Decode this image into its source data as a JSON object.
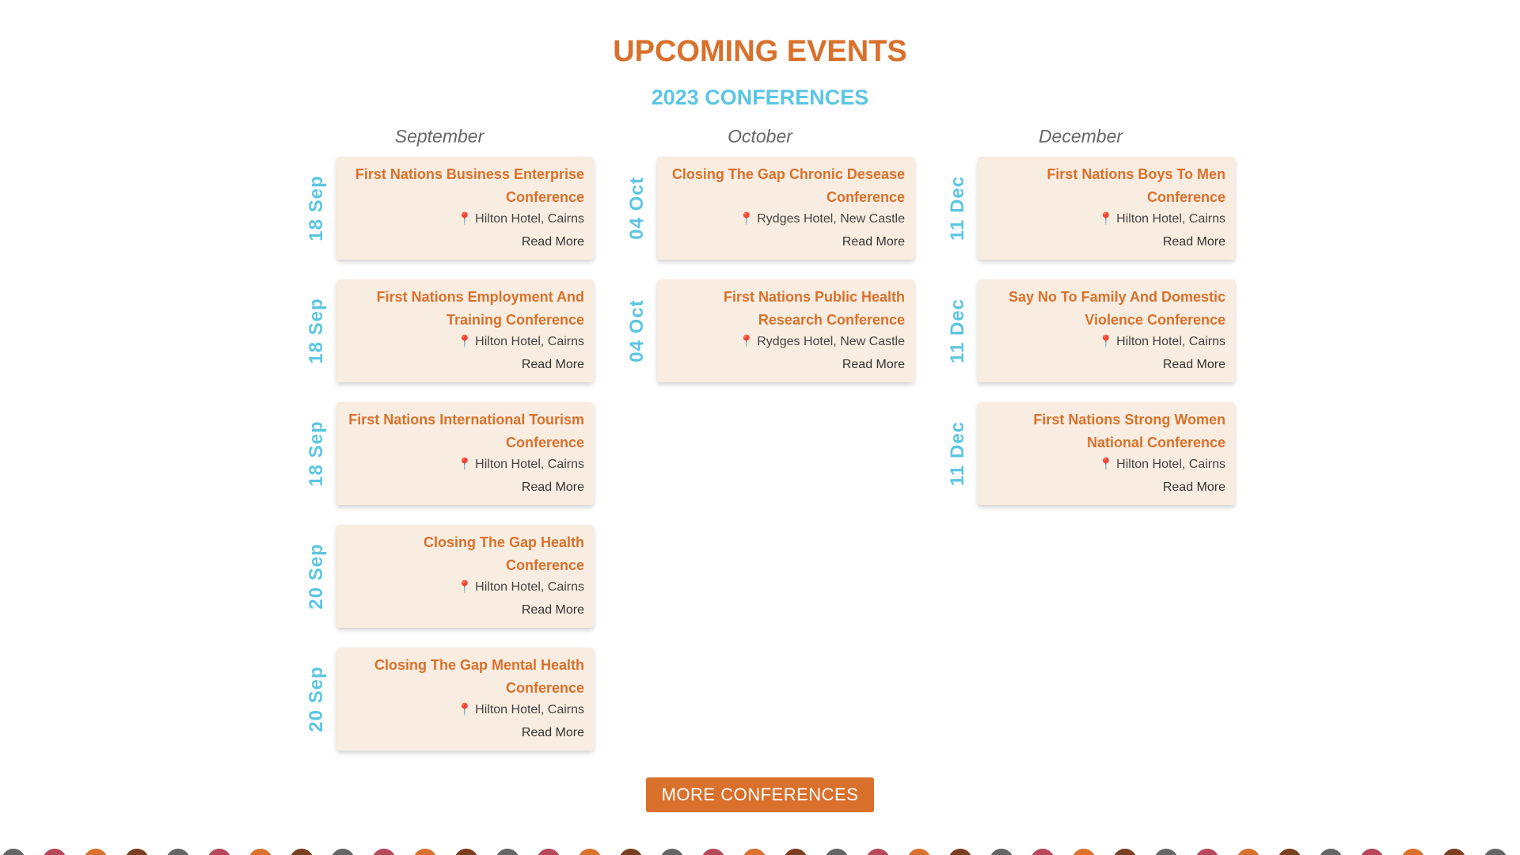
{
  "header": {
    "title": "UPCOMING EVENTS",
    "subtitle": "2023 CONFERENCES"
  },
  "columns": [
    {
      "month": "September",
      "events": [
        {
          "date": "18 Sep",
          "title": "First Nations Business Enterprise Conference",
          "location": "Hilton Hotel, Cairns",
          "link": "Read More"
        },
        {
          "date": "18 Sep",
          "title": "First Nations Employment And Training Conference",
          "location": "Hilton Hotel, Cairns",
          "link": "Read More"
        },
        {
          "date": "18 Sep",
          "title": "First Nations International Tourism Conference",
          "location": "Hilton Hotel, Cairns",
          "link": "Read More"
        },
        {
          "date": "20 Sep",
          "title": "Closing The Gap Health Conference",
          "location": "Hilton Hotel, Cairns",
          "link": "Read More"
        },
        {
          "date": "20 Sep",
          "title": "Closing The Gap Mental Health Conference",
          "location": "Hilton Hotel, Cairns",
          "link": "Read More"
        }
      ]
    },
    {
      "month": "October",
      "events": [
        {
          "date": "04 Oct",
          "title": "Closing The Gap Chronic Desease Conference",
          "location": "Rydges Hotel, New Castle",
          "link": "Read More"
        },
        {
          "date": "04 Oct",
          "title": "First Nations Public Health Research Conference",
          "location": "Rydges Hotel, New Castle",
          "link": "Read More"
        }
      ]
    },
    {
      "month": "December",
      "events": [
        {
          "date": "11 Dec",
          "title": "First Nations Boys To Men Conference",
          "location": "Hilton Hotel, Cairns",
          "link": "Read More"
        },
        {
          "date": "11 Dec",
          "title": "Say No To Family And Domestic Violence Conference",
          "location": "Hilton Hotel, Cairns",
          "link": "Read More"
        },
        {
          "date": "11 Dec",
          "title": "First Nations Strong Women National Conference",
          "location": "Hilton Hotel, Cairns",
          "link": "Read More"
        }
      ]
    }
  ],
  "more_button": {
    "label": "MORE CONFERENCES"
  },
  "icons": {
    "location": "map-pin-icon"
  },
  "colors": {
    "accent": "#d9702b",
    "date": "#5bc6e3",
    "card_bg": "#f9ede1",
    "dots": [
      "#666666",
      "#b5485a",
      "#d9702b",
      "#7a3e20"
    ]
  }
}
